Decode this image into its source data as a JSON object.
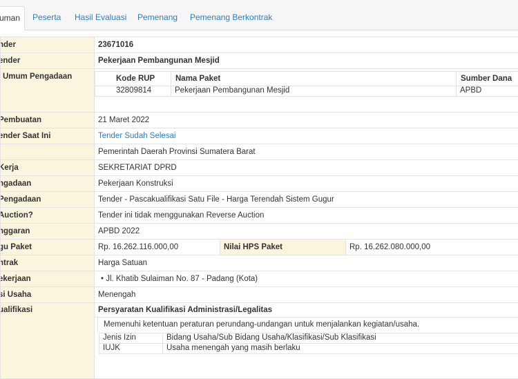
{
  "tabs": [
    "Pengumuman",
    "Peserta",
    "Hasil Evaluasi",
    "Pemenang",
    "Pemenang Berkontrak"
  ],
  "tabs_visible": [
    "uman",
    "Peserta",
    "Hasil Evaluasi",
    "Pemenang",
    "Pemenang Berkontrak"
  ],
  "rows": {
    "kode_tender": {
      "label": "nder",
      "value": "23671016"
    },
    "nama_tender": {
      "label": "ender",
      "value": "Pekerjaan Pembangunan Mesjid"
    },
    "rencana": {
      "label": "Umum Pengadaan"
    },
    "rup_headers": [
      "Kode RUP",
      "Nama Paket",
      "Sumber Dana"
    ],
    "rup_row": [
      "32809814",
      "Pekerjaan Pembangunan Mesjid",
      "APBD"
    ],
    "tanggal": {
      "label": "Pembuatan",
      "value": "21 Maret 2022"
    },
    "tahap": {
      "label": "ender Saat Ini",
      "value": "Tender Sudah Selesai"
    },
    "instansi": {
      "label": "",
      "value": "Pemerintah Daerah Provinsi Sumatera Barat"
    },
    "satker": {
      "label": "Kerja",
      "value": "SEKRETARIAT DPRD"
    },
    "jenis": {
      "label": "ngadaan",
      "value": "Pekerjaan Konstruksi"
    },
    "metode": {
      "label": "Pengadaan",
      "value": "Tender - Pascakualifikasi Satu File - Harga Terendah Sistem Gugur"
    },
    "reverse": {
      "label": "Auction?",
      "value": "Tender ini tidak menggunakan Reverse Auction"
    },
    "anggaran": {
      "label": "nggaran",
      "value": "APBD 2022"
    },
    "pagu": {
      "label": "gu Paket",
      "value": "Rp. 16.262.116.000,00",
      "hps_label": "Nilai HPS Paket",
      "hps_value": "Rp. 16.262.080.000,00"
    },
    "kontrak": {
      "label": "ntrak",
      "value": "Harga Satuan"
    },
    "lokasi": {
      "label": "ekerjaan",
      "value": "Jl. Khatib Sulaiman No. 87 - Padang (Kota)"
    },
    "kualifikasi_usaha": {
      "label": "si Usaha",
      "value": "Menengah"
    },
    "syarat": {
      "label": "ualifikasi",
      "heading": "Persyaratan Kualifikasi Administrasi/Legalitas",
      "desc": "Memenuhi ketentuan peraturan perundang-undangan untuk menjalankan kegiatan/usaha.",
      "izin": [
        [
          "Jenis Izin",
          "Bidang Usaha/Sub Bidang Usaha/Klasifikasi/Sub Klasifikasi"
        ],
        [
          "IUJK",
          "Usaha menengah yang masih berlaku"
        ]
      ]
    }
  }
}
